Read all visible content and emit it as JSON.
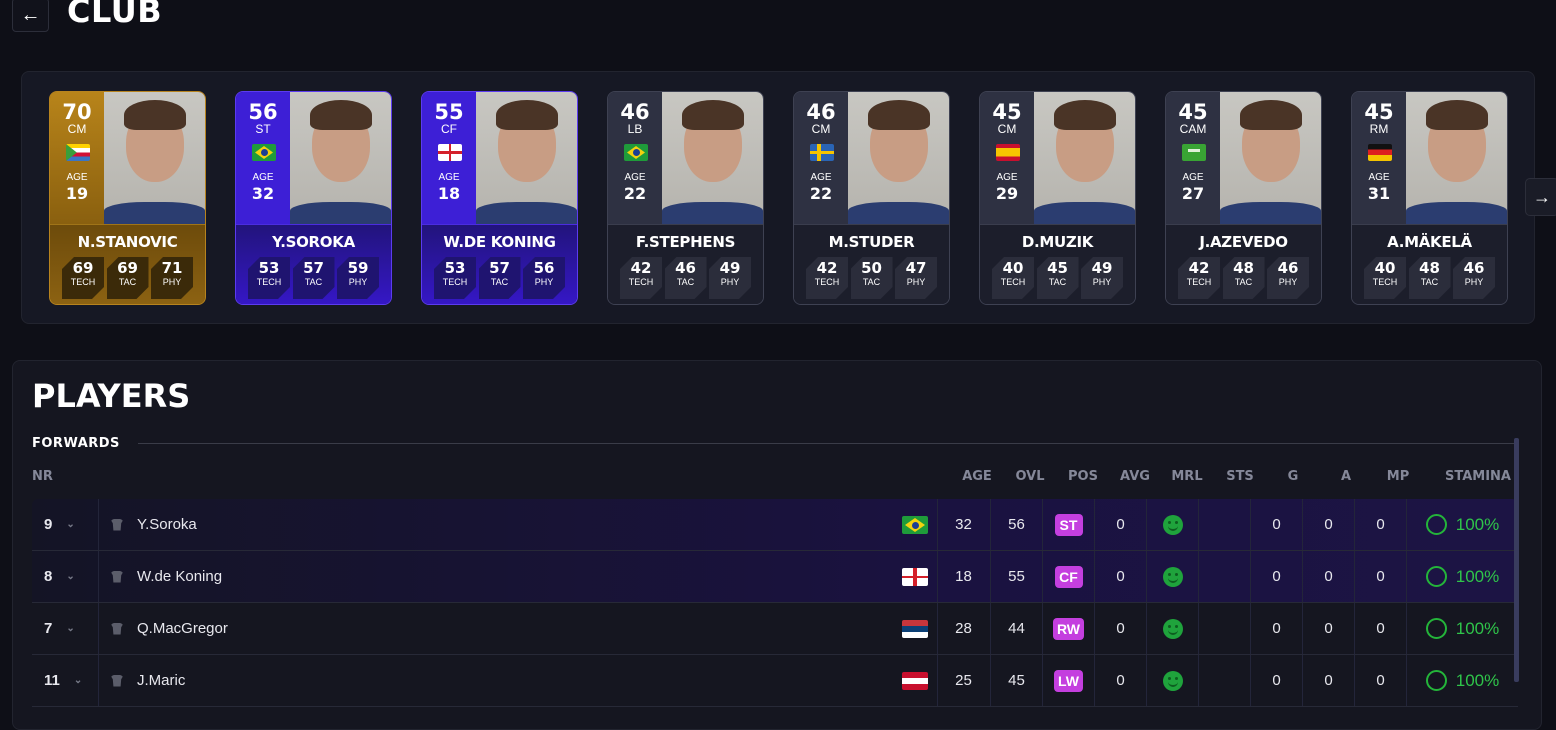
{
  "header": {
    "title": "CLUB",
    "back_icon": "arrow-left-icon"
  },
  "cards": [
    {
      "ovl": "70",
      "pos": "CM",
      "flag": "comoros",
      "age_label": "AGE",
      "age": "19",
      "name": "N.STANOVIC",
      "theme": "gold",
      "stats": [
        {
          "v": "69",
          "l": "TECH"
        },
        {
          "v": "69",
          "l": "TAC"
        },
        {
          "v": "71",
          "l": "PHY"
        }
      ]
    },
    {
      "ovl": "56",
      "pos": "ST",
      "flag": "brazil",
      "age_label": "AGE",
      "age": "32",
      "name": "Y.SOROKA",
      "theme": "purple",
      "stats": [
        {
          "v": "53",
          "l": "TECH"
        },
        {
          "v": "57",
          "l": "TAC"
        },
        {
          "v": "59",
          "l": "PHY"
        }
      ]
    },
    {
      "ovl": "55",
      "pos": "CF",
      "flag": "england",
      "age_label": "AGE",
      "age": "18",
      "name": "W.DE KONING",
      "theme": "purple",
      "stats": [
        {
          "v": "53",
          "l": "TECH"
        },
        {
          "v": "57",
          "l": "TAC"
        },
        {
          "v": "56",
          "l": "PHY"
        }
      ]
    },
    {
      "ovl": "46",
      "pos": "LB",
      "flag": "brazil",
      "age_label": "AGE",
      "age": "22",
      "name": "F.STEPHENS",
      "theme": "gray",
      "stats": [
        {
          "v": "42",
          "l": "TECH"
        },
        {
          "v": "46",
          "l": "TAC"
        },
        {
          "v": "49",
          "l": "PHY"
        }
      ]
    },
    {
      "ovl": "46",
      "pos": "CM",
      "flag": "sweden",
      "age_label": "AGE",
      "age": "22",
      "name": "M.STUDER",
      "theme": "gray",
      "stats": [
        {
          "v": "42",
          "l": "TECH"
        },
        {
          "v": "50",
          "l": "TAC"
        },
        {
          "v": "47",
          "l": "PHY"
        }
      ]
    },
    {
      "ovl": "45",
      "pos": "CM",
      "flag": "spain",
      "age_label": "AGE",
      "age": "29",
      "name": "D.MUZIK",
      "theme": "gray",
      "stats": [
        {
          "v": "40",
          "l": "TECH"
        },
        {
          "v": "45",
          "l": "TAC"
        },
        {
          "v": "49",
          "l": "PHY"
        }
      ]
    },
    {
      "ovl": "45",
      "pos": "CAM",
      "flag": "saudi-arabia",
      "age_label": "AGE",
      "age": "27",
      "name": "J.AZEVEDO",
      "theme": "gray",
      "stats": [
        {
          "v": "42",
          "l": "TECH"
        },
        {
          "v": "48",
          "l": "TAC"
        },
        {
          "v": "46",
          "l": "PHY"
        }
      ]
    },
    {
      "ovl": "45",
      "pos": "RM",
      "flag": "germany",
      "age_label": "AGE",
      "age": "31",
      "name": "A.MÄKELÄ",
      "theme": "gray",
      "stats": [
        {
          "v": "40",
          "l": "TECH"
        },
        {
          "v": "48",
          "l": "TAC"
        },
        {
          "v": "46",
          "l": "PHY"
        }
      ]
    }
  ],
  "carousel": {
    "next_icon": "arrow-right-icon"
  },
  "players": {
    "title": "PLAYERS",
    "section": "FORWARDS",
    "columns": [
      "NR",
      "AGE",
      "OVL",
      "POS",
      "AVG",
      "MRL",
      "STS",
      "G",
      "A",
      "MP",
      "STAMINA"
    ],
    "rows": [
      {
        "nr": "9",
        "name": "Y.Soroka",
        "flag": "brazil",
        "age": "32",
        "ovl": "56",
        "pos": "ST",
        "avg": "0",
        "mrl": "happy",
        "sts": "",
        "g": "0",
        "a": "0",
        "mp": "0",
        "stamina": "100%",
        "highlight": true
      },
      {
        "nr": "8",
        "name": "W.de Koning",
        "flag": "england",
        "age": "18",
        "ovl": "55",
        "pos": "CF",
        "avg": "0",
        "mrl": "happy",
        "sts": "",
        "g": "0",
        "a": "0",
        "mp": "0",
        "stamina": "100%",
        "highlight": true
      },
      {
        "nr": "7",
        "name": "Q.MacGregor",
        "flag": "serbia",
        "age": "28",
        "ovl": "44",
        "pos": "RW",
        "avg": "0",
        "mrl": "happy",
        "sts": "",
        "g": "0",
        "a": "0",
        "mp": "0",
        "stamina": "100%",
        "highlight": false
      },
      {
        "nr": "11",
        "name": "J.Maric",
        "flag": "austria",
        "age": "25",
        "ovl": "45",
        "pos": "LW",
        "avg": "0",
        "mrl": "happy",
        "sts": "",
        "g": "0",
        "a": "0",
        "mp": "0",
        "stamina": "100%",
        "highlight": false
      }
    ]
  },
  "colors": {
    "gold": "#b7831e",
    "purple": "#3d1fd6",
    "pos_badge": "#c43fdf",
    "stamina_green": "#2fc44a",
    "morale_green": "#1fa33c"
  }
}
